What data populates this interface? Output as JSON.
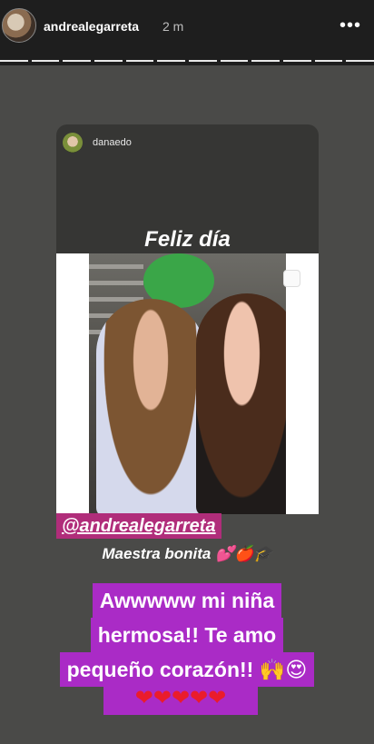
{
  "header": {
    "username": "andrealegarreta",
    "time": "2 m",
    "more_label": "•••"
  },
  "progress": {
    "segments": 12
  },
  "repost": {
    "username": "danaedo",
    "title": "Feliz día",
    "mention": "@andrealegarreta",
    "caption": "Maestra bonita 💕🍎🎓"
  },
  "message": {
    "lines": [
      "Awwwww mi niña",
      "hermosa!! Te amo",
      "pequeño corazón!! 🙌😍"
    ],
    "hearts": "❤❤❤❤❤"
  },
  "colors": {
    "mention_bg": "#b02d7a",
    "message_bg": "#aa2bc6",
    "heart": "#ea1c2b"
  }
}
